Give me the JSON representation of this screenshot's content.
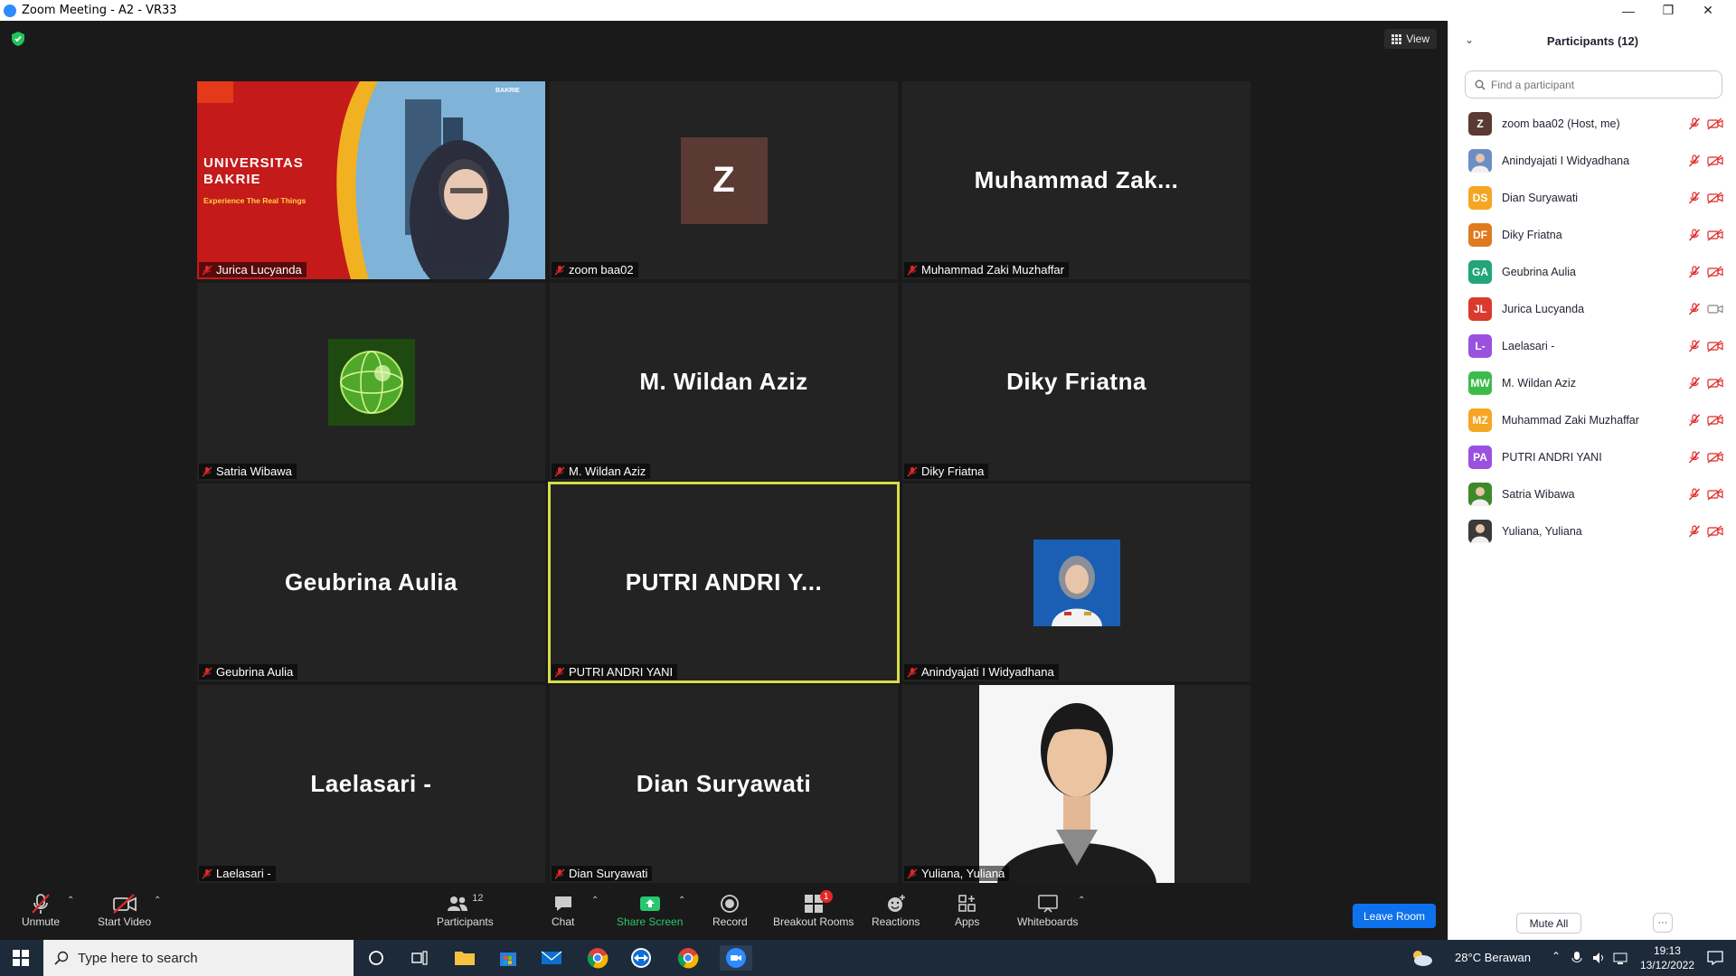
{
  "window": {
    "title": "Zoom Meeting - A2 - VR33",
    "minimize": "—",
    "restore": "❐",
    "close": "✕"
  },
  "meeting": {
    "view_label": "View",
    "tiles": [
      {
        "label": "Jurica Lucyanda",
        "kind": "video",
        "banner_title": "UNIVERSITAS\nBAKRIE",
        "banner_sub": "Experience The Real Things",
        "logo": "BAKRIE"
      },
      {
        "label": "zoom baa02",
        "kind": "letter",
        "letter": "Z",
        "bg": "#5b3a33"
      },
      {
        "label": "Muhammad Zaki Muzhaffar",
        "kind": "name",
        "bigname": "Muhammad  Zak..."
      },
      {
        "label": "Satria Wibawa",
        "kind": "image",
        "icon": "green-globe"
      },
      {
        "label": "M. Wildan Aziz",
        "kind": "name",
        "bigname": "M. Wildan Aziz"
      },
      {
        "label": "Diky Friatna",
        "kind": "name",
        "bigname": "Diky Friatna"
      },
      {
        "label": "Geubrina Aulia",
        "kind": "name",
        "bigname": "Geubrina Aulia"
      },
      {
        "label": "PUTRI ANDRI YANI",
        "kind": "name",
        "bigname": "PUTRI ANDRI Y...",
        "active": true
      },
      {
        "label": "Anindyajati I Widyadhana",
        "kind": "photo"
      },
      {
        "label": "Laelasari -",
        "kind": "name",
        "bigname": "Laelasari -"
      },
      {
        "label": "Dian Suryawati",
        "kind": "name",
        "bigname": "Dian Suryawati"
      },
      {
        "label": "Yuliana, Yuliana",
        "kind": "photo-large"
      }
    ]
  },
  "toolbar": {
    "unmute": "Unmute",
    "start_video": "Start Video",
    "participants": "Participants",
    "participants_count": "12",
    "chat": "Chat",
    "share_screen": "Share Screen",
    "record": "Record",
    "breakout_rooms": "Breakout Rooms",
    "breakout_badge": "1",
    "reactions": "Reactions",
    "apps": "Apps",
    "whiteboards": "Whiteboards",
    "leave": "Leave Room",
    "accent": "#0e72ed",
    "share_color": "#28c76f"
  },
  "panel": {
    "title": "Participants (12)",
    "search_placeholder": "Find a participant",
    "participants": [
      {
        "name": "zoom baa02 (Host, me)",
        "initials": "Z",
        "color": "#5b3a33",
        "cam": "off"
      },
      {
        "name": "Anindyajati I Widyadhana",
        "initials": "",
        "color": "#6b8fc4",
        "cam": "off",
        "photo": true
      },
      {
        "name": "Dian Suryawati",
        "initials": "DS",
        "color": "#f5a623",
        "cam": "off"
      },
      {
        "name": "Diky Friatna",
        "initials": "DF",
        "color": "#e07a1f",
        "cam": "off"
      },
      {
        "name": "Geubrina Aulia",
        "initials": "GA",
        "color": "#22a57a",
        "cam": "off"
      },
      {
        "name": "Jurica Lucyanda",
        "initials": "JL",
        "color": "#d93a2e",
        "cam": "on"
      },
      {
        "name": "Laelasari -",
        "initials": "L-",
        "color": "#9b51e0",
        "cam": "off"
      },
      {
        "name": "M. Wildan Aziz",
        "initials": "MW",
        "color": "#3dbb4a",
        "cam": "off"
      },
      {
        "name": "Muhammad Zaki Muzhaffar",
        "initials": "MZ",
        "color": "#f5a623",
        "cam": "off"
      },
      {
        "name": "PUTRI ANDRI YANI",
        "initials": "PA",
        "color": "#9b51e0",
        "cam": "off"
      },
      {
        "name": "Satria Wibawa",
        "initials": "",
        "color": "#3d8a2a",
        "cam": "off",
        "photo": true
      },
      {
        "name": "Yuliana, Yuliana",
        "initials": "",
        "color": "#3a3a3a",
        "cam": "off",
        "photo": true
      }
    ],
    "mute_all": "Mute All",
    "more": "···"
  },
  "taskbar": {
    "search_placeholder": "Type here to search",
    "weather": "28°C  Berawan",
    "time": "19:13",
    "date": "13/12/2022"
  }
}
